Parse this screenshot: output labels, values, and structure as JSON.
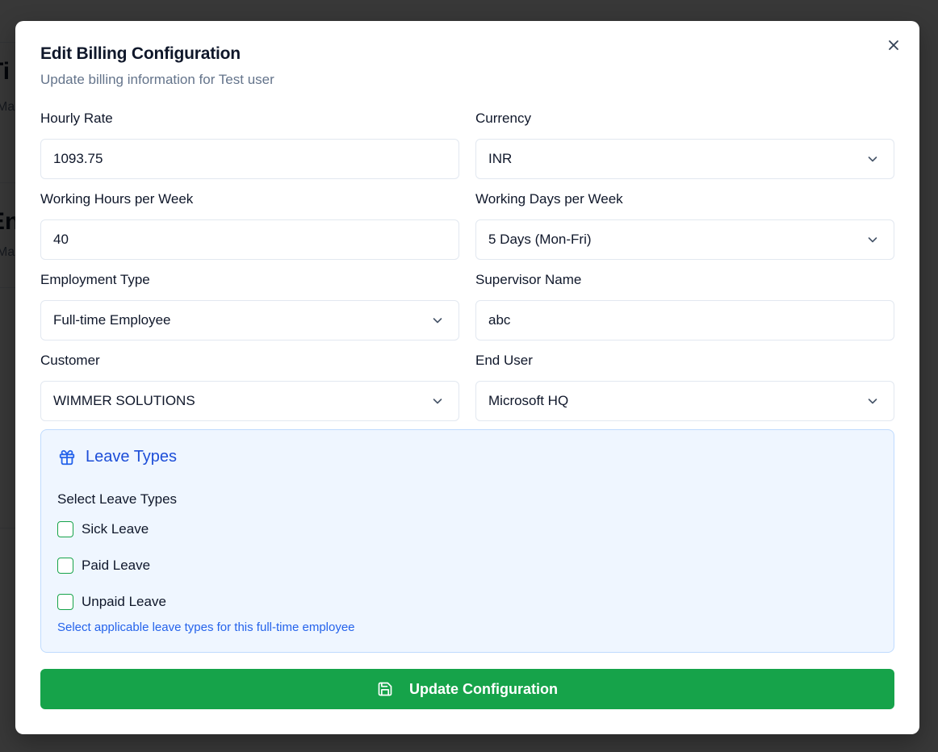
{
  "modal": {
    "title": "Edit Billing Configuration",
    "subtitle": "Update billing information for Test user"
  },
  "fields": {
    "hourly_rate": {
      "label": "Hourly Rate",
      "value": "1093.75"
    },
    "currency": {
      "label": "Currency",
      "value": "INR"
    },
    "working_hours": {
      "label": "Working Hours per Week",
      "value": "40"
    },
    "working_days": {
      "label": "Working Days per Week",
      "value": "5 Days (Mon-Fri)"
    },
    "employment_type": {
      "label": "Employment Type",
      "value": "Full-time Employee"
    },
    "supervisor": {
      "label": "Supervisor Name",
      "value": "abc"
    },
    "customer": {
      "label": "Customer",
      "value": "WIMMER SOLUTIONS"
    },
    "end_user": {
      "label": "End User",
      "value": "Microsoft HQ"
    }
  },
  "leave": {
    "title": "Leave Types",
    "select_label": "Select Leave Types",
    "options": [
      {
        "label": "Sick Leave",
        "checked": false
      },
      {
        "label": "Paid Leave",
        "checked": false
      },
      {
        "label": "Unpaid Leave",
        "checked": false
      }
    ],
    "hint": "Select applicable leave types for this full-time employee"
  },
  "submit_label": "Update Configuration",
  "colors": {
    "accent_green": "#16a34a",
    "leave_blue": "#1d4ed8",
    "panel_bg": "#eff6ff"
  }
}
